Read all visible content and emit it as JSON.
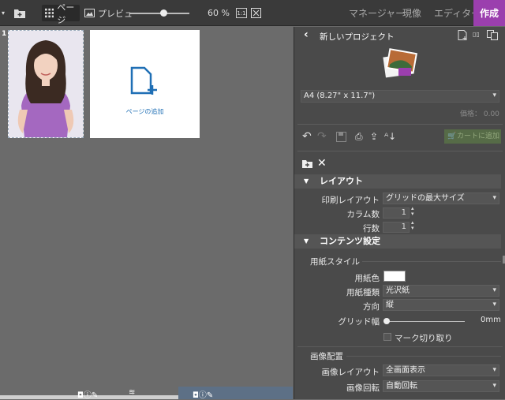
{
  "toolbar": {
    "page_label": "ページ",
    "preview_label": "プレビュー",
    "zoom": "60 %",
    "fit_label": "1:1",
    "modes": [
      "マネージャー",
      "現像",
      "エディター",
      "作成"
    ]
  },
  "canvas": {
    "page_number": "1",
    "add_page_label": "ページの追加"
  },
  "panel": {
    "project_title": "新しいプロジェクト",
    "paper_size": "A4 (8.27\" x 11.7\")",
    "price": "価格： 0.00",
    "cart_label": "カートに追加",
    "layout_section": "レイアウト",
    "print_layout_label": "印刷レイアウト",
    "print_layout_value": "グリッドの最大サイズ",
    "columns_label": "カラム数",
    "columns_value": "1",
    "rows_label": "行数",
    "rows_value": "1",
    "content_section": "コンテンツ設定",
    "paper_style_heading": "用紙スタイル",
    "paper_color_label": "用紙色",
    "paper_color": "#ffffff",
    "paper_type_label": "用紙種類",
    "paper_type_value": "光沢紙",
    "orientation_label": "方向",
    "orientation_value": "縦",
    "grid_width_label": "グリッド幅",
    "grid_width_value": "0mm",
    "crop_marks_label": "マーク切り取り",
    "image_placement_heading": "画像配置",
    "image_layout_label": "画像レイアウト",
    "image_layout_value": "全画面表示",
    "image_rotation_label": "画像回転",
    "image_rotation_value": "自動回転"
  },
  "colors": {
    "accent": "#9b3fae",
    "add_page_icon": "#1f6fb5"
  }
}
